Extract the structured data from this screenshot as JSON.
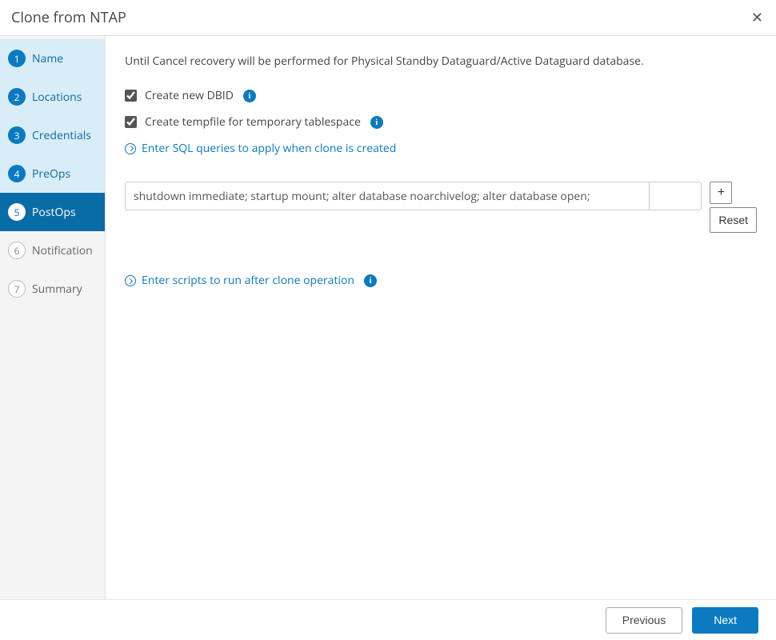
{
  "header": {
    "title": "Clone from NTAP"
  },
  "sidebar": {
    "steps": [
      {
        "num": "1",
        "label": "Name",
        "state": "completed"
      },
      {
        "num": "2",
        "label": "Locations",
        "state": "completed"
      },
      {
        "num": "3",
        "label": "Credentials",
        "state": "completed"
      },
      {
        "num": "4",
        "label": "PreOps",
        "state": "completed"
      },
      {
        "num": "5",
        "label": "PostOps",
        "state": "active"
      },
      {
        "num": "6",
        "label": "Notification",
        "state": "upcoming"
      },
      {
        "num": "7",
        "label": "Summary",
        "state": "upcoming"
      }
    ]
  },
  "content": {
    "intro": "Until Cancel recovery will be performed for Physical Standby Dataguard/Active Dataguard database.",
    "checkbox_dbid": "Create new DBID",
    "checkbox_tempfile": "Create tempfile for temporary tablespace",
    "sql_link": "Enter SQL queries to apply when clone is created",
    "sql_value": "shutdown immediate; startup mount; alter database noarchivelog; alter database open;",
    "plus_label": "+",
    "reset_label": "Reset",
    "scripts_link": "Enter scripts to run after clone operation"
  },
  "footer": {
    "previous": "Previous",
    "next": "Next"
  }
}
